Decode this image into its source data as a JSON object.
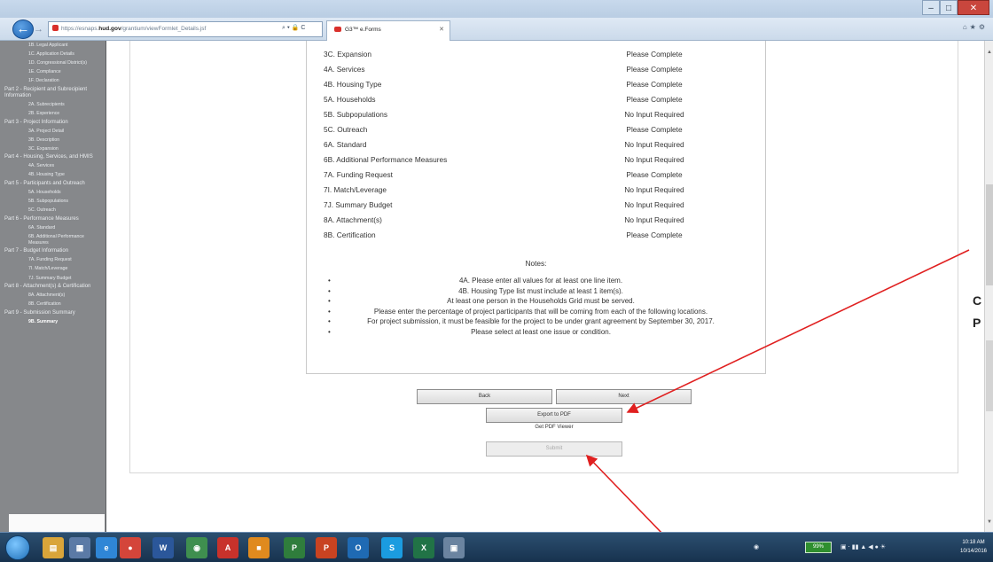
{
  "browser": {
    "address": {
      "scheme": "https://",
      "host_plain": "esnaps.",
      "host_bold": "hud.gov",
      "path": "/grantium/viewFormlet_Details.jsf"
    },
    "address_tools": "⌕ ▾ 🔒 C",
    "tab": {
      "title": "G3™ e.Forms"
    },
    "win_controls": {
      "minimize": "‒",
      "maximize": "□",
      "close": "✕"
    }
  },
  "sidebar": {
    "items": [
      {
        "label": "1B. Legal Applicant",
        "kind": "sub"
      },
      {
        "label": "1C. Application Details",
        "kind": "sub"
      },
      {
        "label": "1D. Congressional District(s)",
        "kind": "sub"
      },
      {
        "label": "1E. Compliance",
        "kind": "sub"
      },
      {
        "label": "1F. Declaration",
        "kind": "sub"
      },
      {
        "label": "Part 2 - Recipient and Subrecipient Information",
        "kind": "part"
      },
      {
        "label": "2A. Subrecipients",
        "kind": "sub"
      },
      {
        "label": "2B. Experience",
        "kind": "sub"
      },
      {
        "label": "Part 3 - Project Information",
        "kind": "part"
      },
      {
        "label": "3A. Project Detail",
        "kind": "sub"
      },
      {
        "label": "3B. Description",
        "kind": "sub"
      },
      {
        "label": "3C. Expansion",
        "kind": "sub"
      },
      {
        "label": "Part 4 - Housing, Services, and HMIS",
        "kind": "part"
      },
      {
        "label": "4A. Services",
        "kind": "sub"
      },
      {
        "label": "4B. Housing Type",
        "kind": "sub"
      },
      {
        "label": "Part 5 - Participants and Outreach",
        "kind": "part"
      },
      {
        "label": "5A. Households",
        "kind": "sub"
      },
      {
        "label": "5B. Subpopulations",
        "kind": "sub"
      },
      {
        "label": "5C. Outreach",
        "kind": "sub"
      },
      {
        "label": "Part 6 - Performance Measures",
        "kind": "part"
      },
      {
        "label": "6A. Standard",
        "kind": "sub"
      },
      {
        "label": "6B. Additional Performance Measures",
        "kind": "sub"
      },
      {
        "label": "Part 7 - Budget Information",
        "kind": "part"
      },
      {
        "label": "7A. Funding Request",
        "kind": "sub"
      },
      {
        "label": "7I. Match/Leverage",
        "kind": "sub"
      },
      {
        "label": "7J. Summary Budget",
        "kind": "sub"
      },
      {
        "label": "Part 8 - Attachment(s) & Certification",
        "kind": "part"
      },
      {
        "label": "8A. Attachment(s)",
        "kind": "sub"
      },
      {
        "label": "8B. Certification",
        "kind": "sub"
      },
      {
        "label": "Part 9 - Submission Summary",
        "kind": "part"
      },
      {
        "label": "9B. Summary",
        "kind": "sub",
        "active": true
      }
    ]
  },
  "summary": {
    "rows": [
      {
        "label": "3C. Expansion",
        "status": "Please Complete"
      },
      {
        "label": "4A. Services",
        "status": "Please Complete"
      },
      {
        "label": "4B. Housing Type",
        "status": "Please Complete"
      },
      {
        "label": "5A. Households",
        "status": "Please Complete"
      },
      {
        "label": "5B. Subpopulations",
        "status": "No Input Required"
      },
      {
        "label": "5C. Outreach",
        "status": "Please Complete"
      },
      {
        "label": "6A. Standard",
        "status": "No Input Required"
      },
      {
        "label": "6B. Additional Performance Measures",
        "status": "No Input Required"
      },
      {
        "label": "7A. Funding Request",
        "status": "Please Complete"
      },
      {
        "label": "7I. Match/Leverage",
        "status": "No Input Required"
      },
      {
        "label": "7J. Summary Budget",
        "status": "No Input Required"
      },
      {
        "label": "8A. Attachment(s)",
        "status": "No Input Required"
      },
      {
        "label": "8B. Certification",
        "status": "Please Complete"
      }
    ],
    "notes_title": "Notes:",
    "notes": [
      "4A. Please enter all values for at least one line item.",
      "4B. Housing Type list must include at least 1 item(s).",
      "At least one person in the Households Grid must be served.",
      "Please enter the percentage of project participants that will be coming from each of the following locations.",
      "For project submission, it must be feasible for the project to be under grant agreement by September 30, 2017.",
      "Please select at least one issue or condition."
    ],
    "bullet": "•"
  },
  "buttons": {
    "back": "Back",
    "next": "Next",
    "export_pdf": "Export to PDF",
    "get_pdf_viewer": "Get PDF Viewer",
    "submit": "Submit"
  },
  "callout": {
    "line1": "C",
    "line2": "P"
  },
  "taskbar": {
    "apps": [
      {
        "name": "explorer",
        "glyph": "▤",
        "color": "#d9a53a"
      },
      {
        "name": "calculator",
        "glyph": "▦",
        "color": "#5b7aa6"
      },
      {
        "name": "internet-explorer",
        "glyph": "e",
        "color": "#2f86d6"
      },
      {
        "name": "chrome",
        "glyph": "●",
        "color": "#d4453a"
      },
      {
        "name": "word",
        "glyph": "W",
        "color": "#2b579a"
      },
      {
        "name": "app6",
        "glyph": "◉",
        "color": "#3f8f4f"
      },
      {
        "name": "acrobat",
        "glyph": "A",
        "color": "#c8322b"
      },
      {
        "name": "app8",
        "glyph": "■",
        "color": "#e08a1e"
      },
      {
        "name": "project",
        "glyph": "P",
        "color": "#2f7d3c"
      },
      {
        "name": "powerpoint",
        "glyph": "P",
        "color": "#c84321"
      },
      {
        "name": "outlook",
        "glyph": "O",
        "color": "#1f6ab3"
      },
      {
        "name": "skype",
        "glyph": "S",
        "color": "#1b9ce0"
      },
      {
        "name": "excel",
        "glyph": "X",
        "color": "#217346"
      },
      {
        "name": "notes",
        "glyph": "▣",
        "color": "#6b84a0"
      }
    ],
    "battery": "99%",
    "clock": {
      "time": "10:18 AM",
      "date": "10/14/2016"
    }
  }
}
